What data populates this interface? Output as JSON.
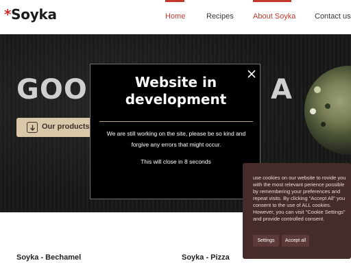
{
  "header": {
    "logo_star": "*",
    "logo_text": "Soyka",
    "nav": [
      {
        "label": "Home",
        "active": true
      },
      {
        "label": "Recipes",
        "active": false
      },
      {
        "label": "About Soyka",
        "active": true
      },
      {
        "label": "Contact us",
        "active": false
      }
    ]
  },
  "hero": {
    "title": "GOOD",
    "title_tail": "A",
    "cta_label": "Our products",
    "cta_icon": "arrow-down-icon"
  },
  "products": [
    "Soyka - Bechamel",
    "Soyka - Pizza"
  ],
  "modal": {
    "title": "Website in development",
    "message": "We are still working on the site, please be so kind and forgive any errors that might occur.",
    "timer": "This will close in 8 seconds",
    "close_icon": "close-icon"
  },
  "cookie": {
    "text": "use cookies on our website to rovide you with the most relevant perience possible by remembering your preferences and repeat visits. By clicking \"Accept All\" you consent to the use of ALL cookies. However, you can visit \"Cookie Settings\" and provide controlled consent.",
    "settings_label": "Settings",
    "accept_label": "Accept all"
  },
  "colors": {
    "accent_red": "#c0392b",
    "cta_beige": "#d9c9aa",
    "cookie_bg": "#452b2a",
    "modal_bg": "#000000"
  }
}
